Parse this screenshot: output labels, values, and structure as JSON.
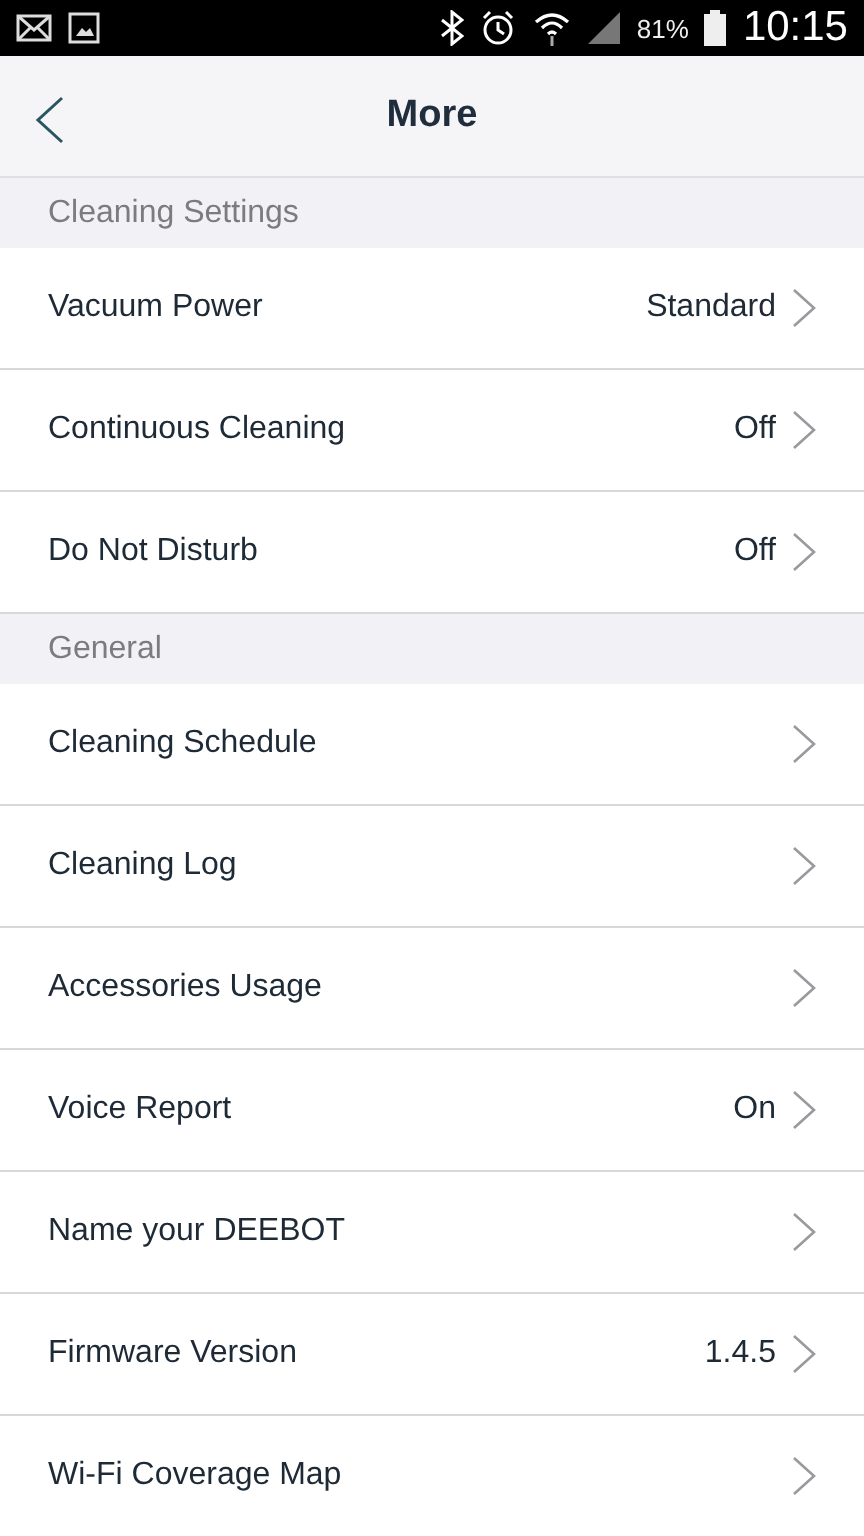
{
  "status_bar": {
    "battery": "81%",
    "time": "10:15"
  },
  "header": {
    "title": "More"
  },
  "sections": [
    {
      "title": "Cleaning Settings",
      "items": [
        {
          "label": "Vacuum Power",
          "value": "Standard"
        },
        {
          "label": "Continuous Cleaning",
          "value": "Off"
        },
        {
          "label": "Do Not Disturb",
          "value": "Off"
        }
      ]
    },
    {
      "title": "General",
      "items": [
        {
          "label": "Cleaning Schedule"
        },
        {
          "label": "Cleaning Log"
        },
        {
          "label": "Accessories Usage"
        },
        {
          "label": "Voice Report",
          "value": "On"
        },
        {
          "label": "Name your DEEBOT"
        },
        {
          "label": "Firmware Version",
          "value": "1.4.5"
        },
        {
          "label": "Wi-Fi Coverage Map"
        }
      ]
    }
  ]
}
